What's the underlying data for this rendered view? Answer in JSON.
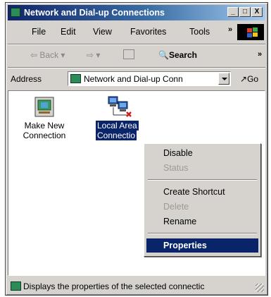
{
  "window": {
    "title": "Network and Dial-up Connections",
    "minimize": "_",
    "restore": "□",
    "close": "X"
  },
  "menubar": {
    "items": [
      "File",
      "Edit",
      "View",
      "Favorites",
      "Tools"
    ],
    "overflow": "»"
  },
  "toolbar": {
    "back": "Back",
    "search": "Search",
    "overflow": "»"
  },
  "address": {
    "label": "Address",
    "value": "Network and Dial-up Conn",
    "go": "Go"
  },
  "items": [
    {
      "line1": "Make New",
      "line2": "Connection"
    },
    {
      "line1": "Local Area",
      "line2": "Connectio"
    }
  ],
  "context_menu": {
    "items": [
      "Disable",
      "Status",
      "Create Shortcut",
      "Delete",
      "Rename",
      "Properties"
    ],
    "disabled": [
      "Status",
      "Delete"
    ],
    "highlighted": "Properties"
  },
  "status_bar": {
    "text": "Displays the properties of the selected connectic"
  },
  "colors": {
    "selection": "#0a246a",
    "title_gradient_start": "#10246a",
    "face": "#d6d3ce"
  }
}
